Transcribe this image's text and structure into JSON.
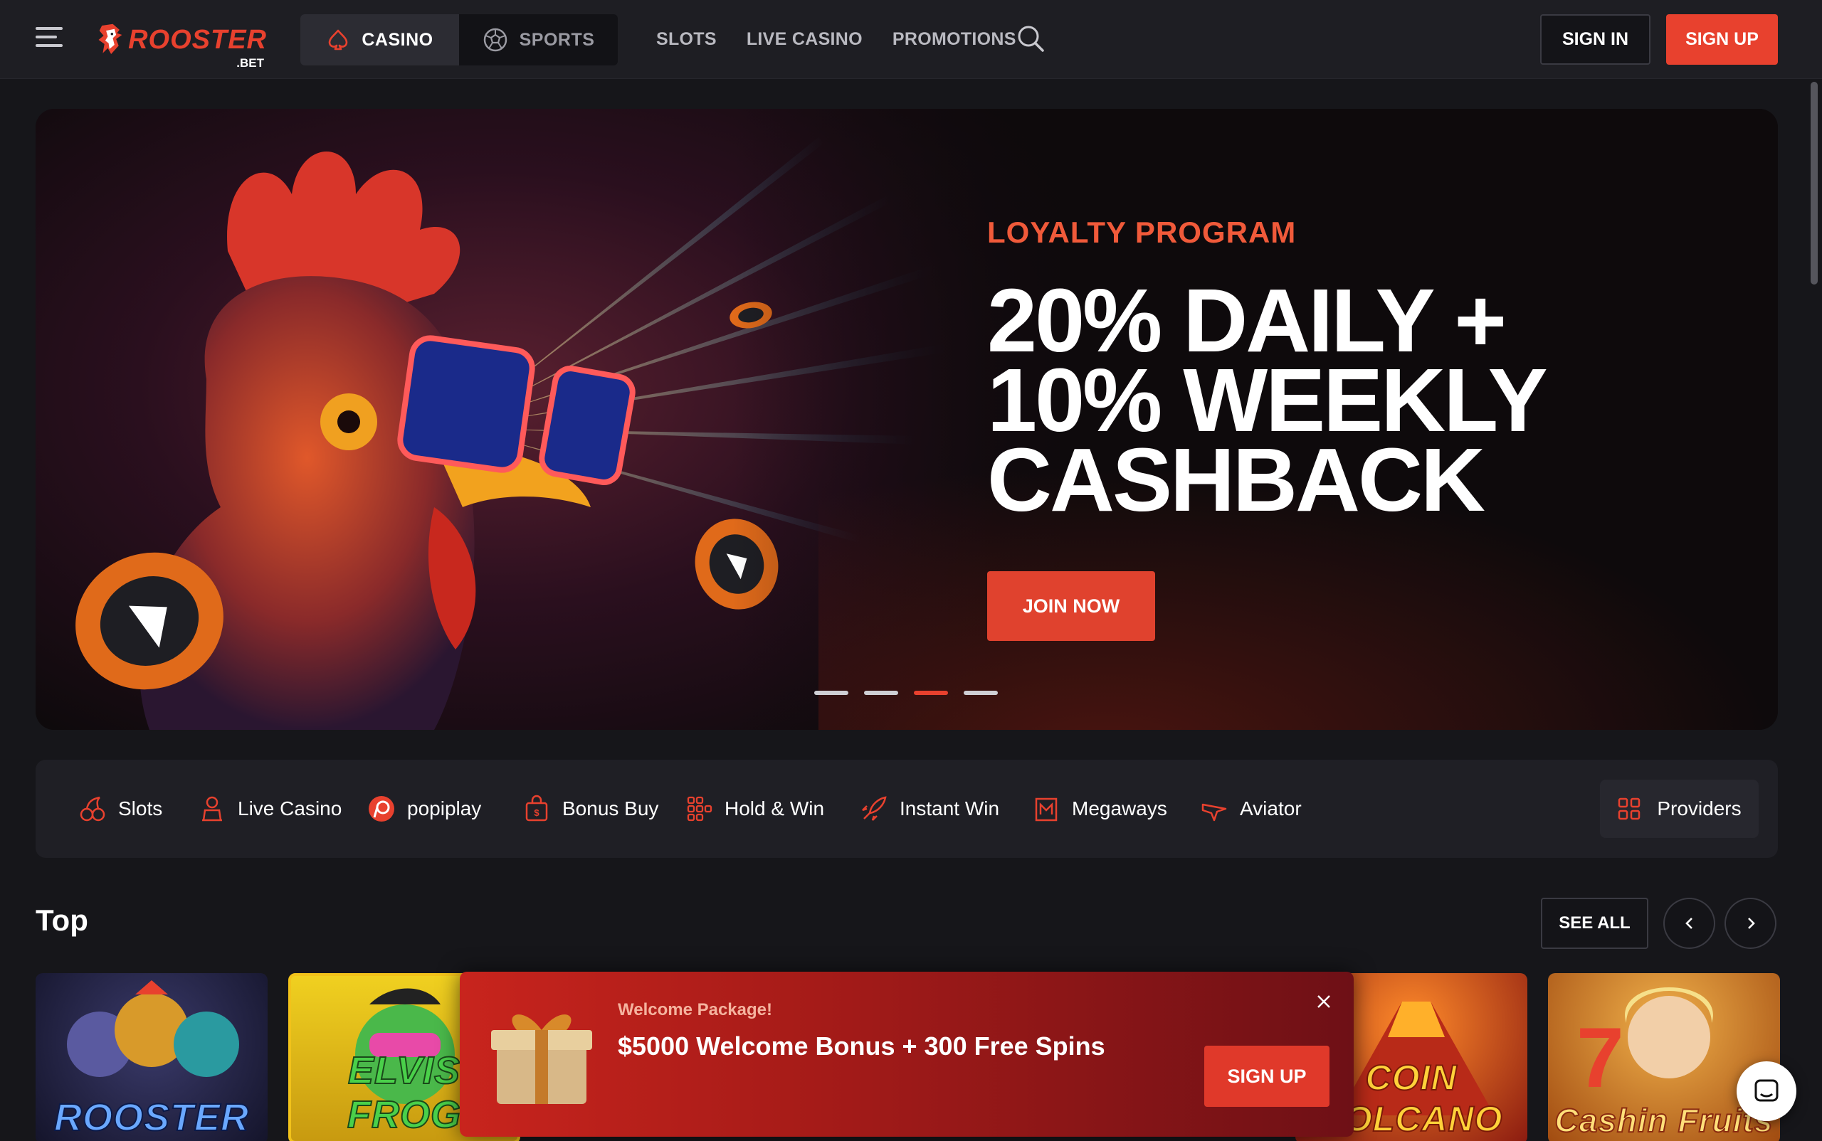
{
  "header": {
    "logo_name": "ROOSTER",
    "logo_sub": ".BET",
    "segments": [
      {
        "label": "CASINO",
        "icon": "spade-icon",
        "active": true
      },
      {
        "label": "SPORTS",
        "icon": "soccer-ball-icon",
        "active": false
      }
    ],
    "nav": [
      "SLOTS",
      "LIVE CASINO",
      "PROMOTIONS"
    ],
    "signin_label": "SIGN IN",
    "signup_label": "SIGN UP"
  },
  "banner": {
    "eyebrow": "LOYALTY PROGRAM",
    "title_lines": [
      "20% DAILY +",
      " 10% WEEKLY",
      "CASHBACK"
    ],
    "cta_label": "JOIN NOW",
    "slides_total": 4,
    "active_slide": 3
  },
  "categories": [
    {
      "label": "Slots",
      "icon": "cherries-icon"
    },
    {
      "label": "Live Casino",
      "icon": "dealer-icon"
    },
    {
      "label": "popiplay",
      "icon": "popiplay-icon"
    },
    {
      "label": "Bonus Buy",
      "icon": "shopping-bag-icon"
    },
    {
      "label": "Hold & Win",
      "icon": "grid-dots-icon"
    },
    {
      "label": "Instant Win",
      "icon": "rocket-icon"
    },
    {
      "label": "Megaways",
      "icon": "megaways-icon"
    },
    {
      "label": "Aviator",
      "icon": "plane-icon"
    }
  ],
  "providers_label": "Providers",
  "top_section": {
    "title": "Top",
    "see_all_label": "SEE ALL",
    "tiles": [
      {
        "label": "ROOSTER"
      },
      {
        "label": "ELVIS FROG"
      },
      {
        "label": "COIN VOLCANO"
      },
      {
        "label": "Cashin Fruits"
      }
    ]
  },
  "popup": {
    "eyebrow": "Welcome Package!",
    "title": "$5000 Welcome Bonus + 300 Free Spins",
    "cta_label": "SIGN UP"
  },
  "colors": {
    "accent": "#e8412e",
    "background": "#16161a",
    "header": "#1e1e23",
    "panel": "#1f1f25"
  }
}
